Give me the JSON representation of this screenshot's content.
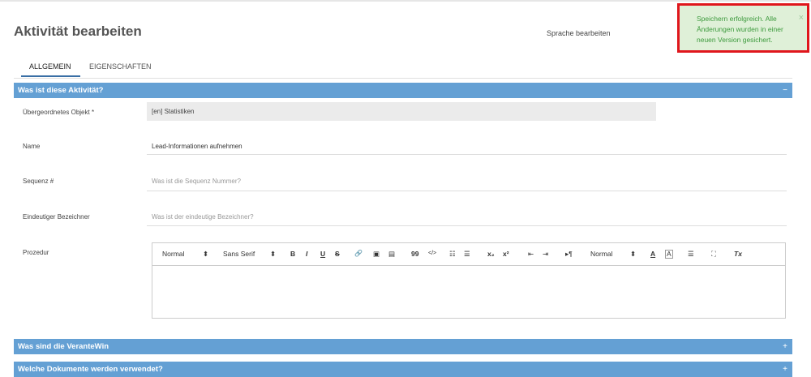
{
  "header": {
    "title": "Aktivität bearbeiten",
    "language_link": "Sprache bearbeiten"
  },
  "toast": {
    "message": "Speichern erfolgreich. Alle Änderungen wurden in einer neuen Version gesichert.",
    "close": "×"
  },
  "tabs": [
    "ALLGEMEIN",
    "EIGENSCHAFTEN"
  ],
  "active_tab": "ALLGEMEIN",
  "sections": [
    {
      "title": "Was ist diese Aktivität?",
      "toggle": "−"
    },
    {
      "title": "Was sind die VeranteWin",
      "toggle": "+"
    },
    {
      "title": "Welche Dokumente werden verwendet?",
      "toggle": "+"
    }
  ],
  "form": {
    "parent": {
      "label": "Übergeordnetes Objekt *",
      "value": "[en] Statistiken"
    },
    "name": {
      "label": "Name",
      "value": "Lead-Informationen aufnehmen"
    },
    "sequence": {
      "label": "Sequenz #",
      "placeholder": "Was ist die Sequenz Nummer?"
    },
    "identifier": {
      "label": "Eindeutiger Bezeichner",
      "placeholder": "Was ist der eindeutige Bezeichner?"
    },
    "procedure": {
      "label": "Prozedur"
    }
  },
  "editor_toolbar": {
    "size_select": "Normal",
    "font_select": "Sans Serif",
    "bold": "B",
    "italic": "I",
    "underline": "U",
    "strike": "S",
    "link_icon": "🔗",
    "image_icon": "▣",
    "video_icon": "▤",
    "quote": "99",
    "code": "</>",
    "ordered_list": "☷",
    "bullet_list": "☰",
    "subscript": "x₂",
    "superscript": "x²",
    "outdent": "⇤",
    "indent": "⇥",
    "direction": "▸¶",
    "header_select": "Normal",
    "font_color": "A",
    "background_color": "A",
    "align": "☰",
    "fullscreen": "⛶",
    "clean": "Tx",
    "select_arrow": "⬍"
  }
}
